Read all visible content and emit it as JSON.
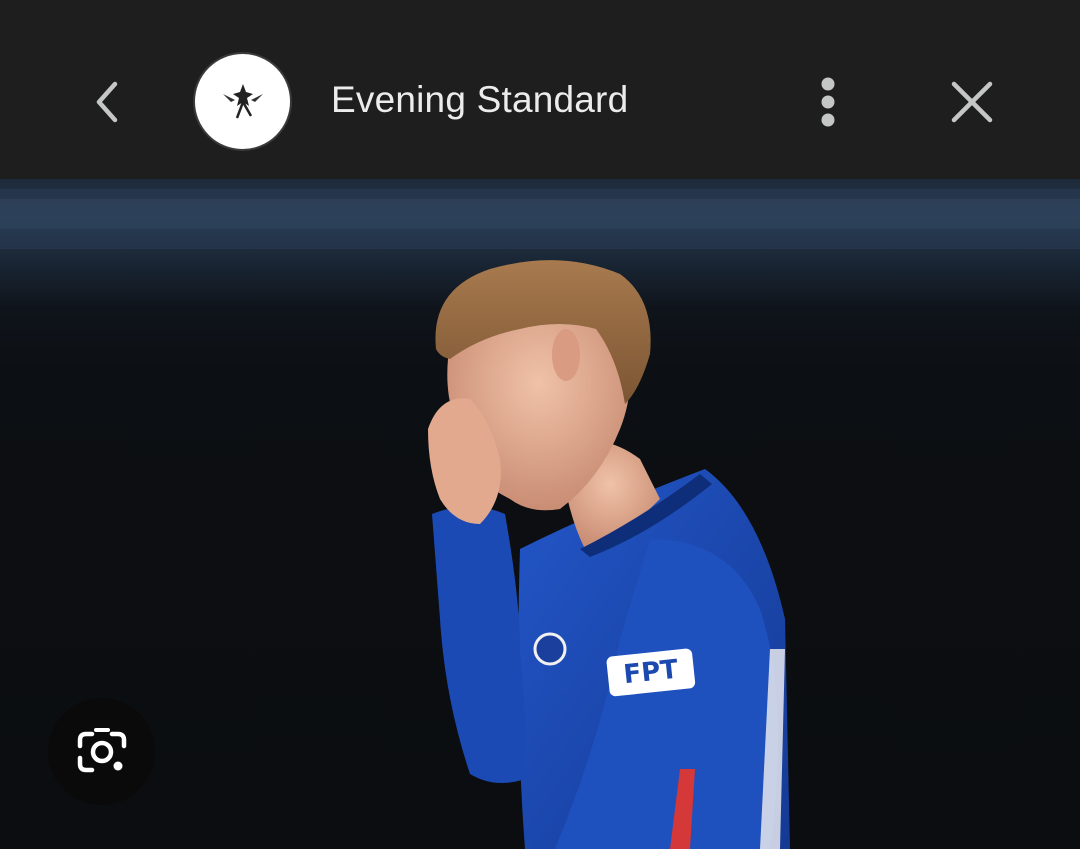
{
  "header": {
    "source_name": "Evening Standard",
    "icons": {
      "back": "chevron-left-icon",
      "logo": "evening-standard-logo",
      "more": "more-vertical-icon",
      "close": "close-icon"
    }
  },
  "image": {
    "description_colors": {
      "kit": "#1b49b0",
      "shirt_sponsor_text": "#ffffff"
    },
    "shirt_sponsor": "FPT"
  },
  "floating": {
    "lens_icon": "google-lens-icon"
  },
  "colors": {
    "bar_background": "#1e1e1f",
    "title_text": "#ececec",
    "icon_grey": "#c4c7c5"
  }
}
